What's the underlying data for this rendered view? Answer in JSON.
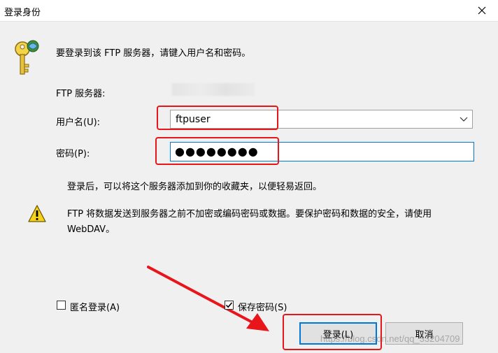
{
  "window": {
    "title": "登录身份",
    "close_symbol": "✕"
  },
  "prompt": "要登录到该 FTP 服务器，请键入用户名和密码。",
  "server": {
    "label": "FTP 服务器:"
  },
  "username": {
    "label": "用户名(U):",
    "value": "ftpuser"
  },
  "password": {
    "label": "密码(P):",
    "value": "●●●●●●●●"
  },
  "favorites_note": "登录后，可以将这个服务器添加到你的收藏夹，以便轻易返回。",
  "warning": {
    "line1": "FTP 将数据发送到服务器之前不加密或编码密码或数据。要保护密码和数据的安全，请使用",
    "line2": "WebDAV。"
  },
  "options": {
    "anonymous": {
      "label": "匿名登录(A)",
      "checked": false
    },
    "save_password": {
      "label": "保存密码(S)",
      "checked": true
    }
  },
  "buttons": {
    "login": "登录(L)",
    "cancel": "取消"
  },
  "watermark": "https://blog.csdn.net/qq_33204709",
  "colors": {
    "annotation_red": "#e8151b",
    "focus_blue": "#0078d7",
    "dialog_bg": "#f0f0f0"
  },
  "icons": [
    "key-icon",
    "warning-icon",
    "chevron-down-icon",
    "close-icon",
    "checkmark-icon"
  ]
}
